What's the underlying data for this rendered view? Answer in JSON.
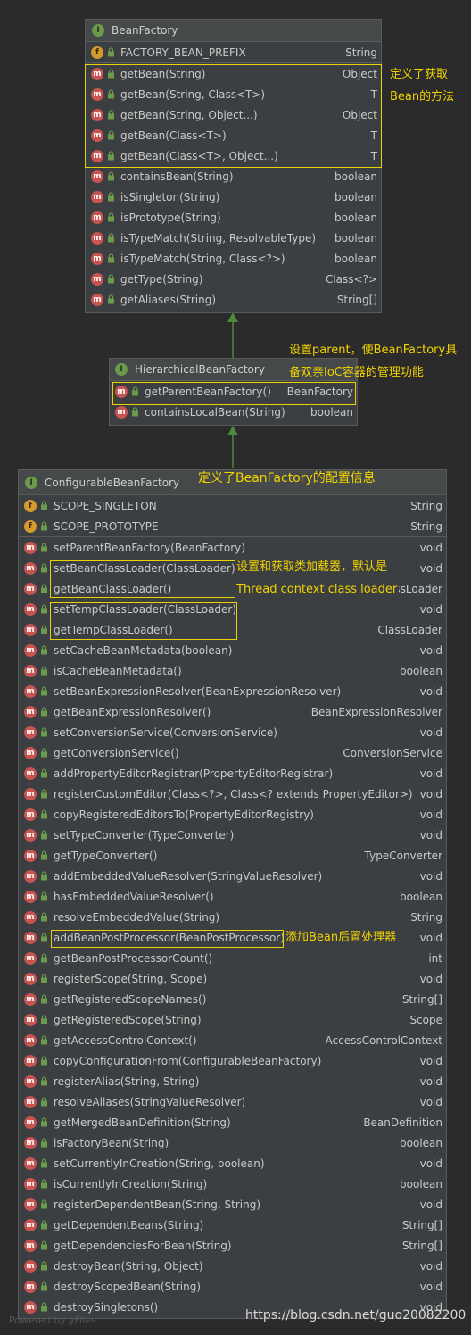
{
  "bean_factory": {
    "title": "BeanFactory",
    "fields": [
      {
        "name": "FACTORY_BEAN_PREFIX",
        "ret": "String"
      }
    ],
    "methods": [
      {
        "name": "getBean(String)",
        "ret": "Object"
      },
      {
        "name": "getBean(String, Class<T>)",
        "ret": "T"
      },
      {
        "name": "getBean(String, Object...)",
        "ret": "Object"
      },
      {
        "name": "getBean(Class<T>)",
        "ret": "T"
      },
      {
        "name": "getBean(Class<T>, Object...)",
        "ret": "T"
      },
      {
        "name": "containsBean(String)",
        "ret": "boolean"
      },
      {
        "name": "isSingleton(String)",
        "ret": "boolean"
      },
      {
        "name": "isPrototype(String)",
        "ret": "boolean"
      },
      {
        "name": "isTypeMatch(String, ResolvableType)",
        "ret": "boolean"
      },
      {
        "name": "isTypeMatch(String, Class<?>)",
        "ret": "boolean"
      },
      {
        "name": "getType(String)",
        "ret": "Class<?>"
      },
      {
        "name": "getAliases(String)",
        "ret": "String[]"
      }
    ]
  },
  "hierarchical": {
    "title": "HierarchicalBeanFactory",
    "methods": [
      {
        "name": "getParentBeanFactory()",
        "ret": "BeanFactory"
      },
      {
        "name": "containsLocalBean(String)",
        "ret": "boolean"
      }
    ]
  },
  "configurable": {
    "title": "ConfigurableBeanFactory",
    "fields": [
      {
        "name": "SCOPE_SINGLETON",
        "ret": "String"
      },
      {
        "name": "SCOPE_PROTOTYPE",
        "ret": "String"
      }
    ],
    "methods": [
      {
        "name": "setParentBeanFactory(BeanFactory)",
        "ret": "void"
      },
      {
        "name": "setBeanClassLoader(ClassLoader)",
        "ret": "void"
      },
      {
        "name": "getBeanClassLoader()",
        "ret": "ClassLoader"
      },
      {
        "name": "setTempClassLoader(ClassLoader)",
        "ret": "void"
      },
      {
        "name": "getTempClassLoader()",
        "ret": "ClassLoader"
      },
      {
        "name": "setCacheBeanMetadata(boolean)",
        "ret": "void"
      },
      {
        "name": "isCacheBeanMetadata()",
        "ret": "boolean"
      },
      {
        "name": "setBeanExpressionResolver(BeanExpressionResolver)",
        "ret": "void"
      },
      {
        "name": "getBeanExpressionResolver()",
        "ret": "BeanExpressionResolver"
      },
      {
        "name": "setConversionService(ConversionService)",
        "ret": "void"
      },
      {
        "name": "getConversionService()",
        "ret": "ConversionService"
      },
      {
        "name": "addPropertyEditorRegistrar(PropertyEditorRegistrar)",
        "ret": "void"
      },
      {
        "name": "registerCustomEditor(Class<?>, Class<? extends PropertyEditor>)",
        "ret": "void"
      },
      {
        "name": "copyRegisteredEditorsTo(PropertyEditorRegistry)",
        "ret": "void"
      },
      {
        "name": "setTypeConverter(TypeConverter)",
        "ret": "void"
      },
      {
        "name": "getTypeConverter()",
        "ret": "TypeConverter"
      },
      {
        "name": "addEmbeddedValueResolver(StringValueResolver)",
        "ret": "void"
      },
      {
        "name": "hasEmbeddedValueResolver()",
        "ret": "boolean"
      },
      {
        "name": "resolveEmbeddedValue(String)",
        "ret": "String"
      },
      {
        "name": "addBeanPostProcessor(BeanPostProcessor)",
        "ret": "void"
      },
      {
        "name": "getBeanPostProcessorCount()",
        "ret": "int"
      },
      {
        "name": "registerScope(String, Scope)",
        "ret": "void"
      },
      {
        "name": "getRegisteredScopeNames()",
        "ret": "String[]"
      },
      {
        "name": "getRegisteredScope(String)",
        "ret": "Scope"
      },
      {
        "name": "getAccessControlContext()",
        "ret": "AccessControlContext"
      },
      {
        "name": "copyConfigurationFrom(ConfigurableBeanFactory)",
        "ret": "void"
      },
      {
        "name": "registerAlias(String, String)",
        "ret": "void"
      },
      {
        "name": "resolveAliases(StringValueResolver)",
        "ret": "void"
      },
      {
        "name": "getMergedBeanDefinition(String)",
        "ret": "BeanDefinition"
      },
      {
        "name": "isFactoryBean(String)",
        "ret": "boolean"
      },
      {
        "name": "setCurrentlyInCreation(String, boolean)",
        "ret": "void"
      },
      {
        "name": "isCurrentlyInCreation(String)",
        "ret": "boolean"
      },
      {
        "name": "registerDependentBean(String, String)",
        "ret": "void"
      },
      {
        "name": "getDependentBeans(String)",
        "ret": "String[]"
      },
      {
        "name": "getDependenciesForBean(String)",
        "ret": "String[]"
      },
      {
        "name": "destroyBean(String, Object)",
        "ret": "void"
      },
      {
        "name": "destroyScopedBean(String)",
        "ret": "void"
      },
      {
        "name": "destroySingletons()",
        "ret": "void"
      }
    ]
  },
  "annotations": {
    "getbean_1": "定义了获取",
    "getbean_2": "Bean的方法",
    "parent_1": "设置parent，使BeanFactory具",
    "parent_2": "备双亲IoC容器的管理功能",
    "config": "定义了BeanFactory的配置信息",
    "classloader_1": "设置和获取类加载器，默认是",
    "classloader_2": "Thread context class loader",
    "postprocessor": "添加Bean后置处理器"
  },
  "icons": {
    "interface": "interface-icon",
    "method": "method-icon",
    "field": "field-icon",
    "public": "lock-icon"
  },
  "colors": {
    "highlight": "#e8d400",
    "annotation": "#f2d300",
    "arrow": "#4d8a3a"
  },
  "footer": {
    "powered": "Powered by yFiles",
    "url": "https://blog.csdn.net/guo20082200"
  }
}
